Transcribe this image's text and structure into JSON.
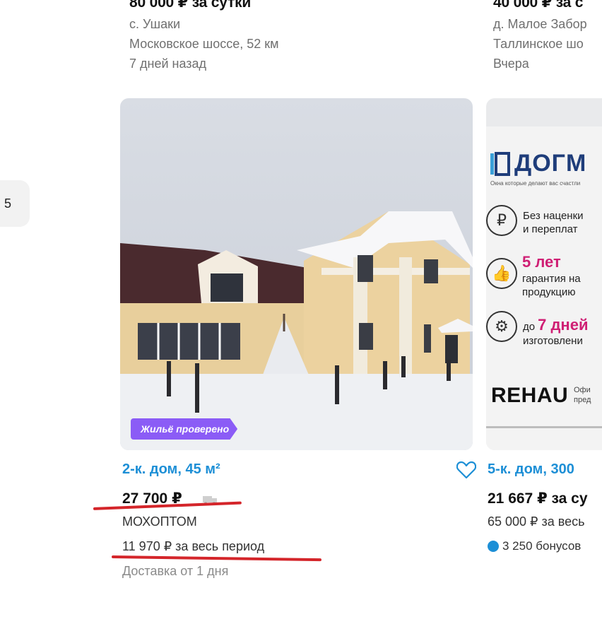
{
  "top_cards": [
    {
      "price": "80 000 ₽ за сутки",
      "location": "с. Ушаки",
      "road": "Московское шоссе, 52 км",
      "date": "7 дней назад"
    },
    {
      "price": "40 000 ₽ за с",
      "location": "д. Малое Забор",
      "road": "Таллинское шо",
      "date": "Вчера"
    }
  ],
  "pagination": {
    "page": "5"
  },
  "listing1": {
    "badge": "Жильё проверено",
    "title": "2-к. дом, 45 м²",
    "price": "27 700 ₽",
    "seller": "МОХОПТОМ",
    "installment": "11 970 ₽ за весь период",
    "delivery": "Доставка от 1 дня"
  },
  "listing2": {
    "ad": {
      "logo": "ДОГМ",
      "tagline": "Окна которые делают вас счастли",
      "line1a": "Без наценки",
      "line1b": "и переплат",
      "big2": "5 лет",
      "line2a": "гарантия на",
      "line2b": "продукцию",
      "big3_prefix": "до",
      "big3": "7 дней",
      "line3": "изготовлени",
      "brand": "REHAU",
      "brand_note": "Офи",
      "brand_note2": "пред"
    },
    "title": "5-к. дом, 300",
    "price": "21 667 ₽ за су",
    "sub": "65 000 ₽ за весь",
    "bonus": "3 250 бонусов"
  },
  "colors": {
    "link": "#1d8fd6",
    "badge": "#8b5cf6",
    "annotation": "#d4252a",
    "promo": "#cf1f74"
  }
}
